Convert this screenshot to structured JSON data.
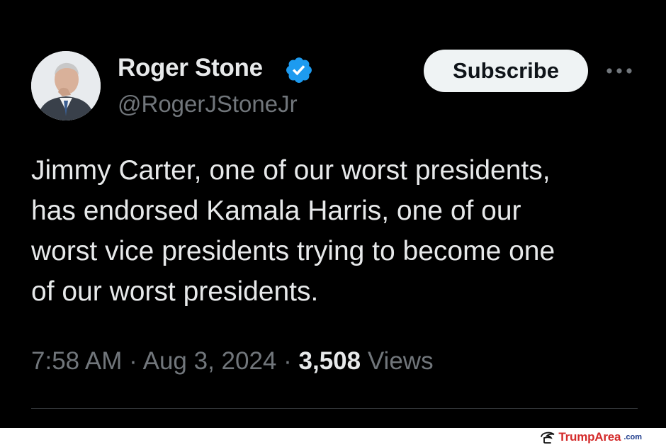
{
  "tweet": {
    "author": {
      "display_name": "Roger Stone",
      "handle": "@RogerJStoneJr",
      "verified": true,
      "verified_color": "#1d9bf0"
    },
    "subscribe_label": "Subscribe",
    "text": "Jimmy Carter, one of our worst presidents,\nhas endorsed Kamala Harris, one of our\nworst vice presidents trying to become one\nof our worst presidents.",
    "time": "7:58 AM",
    "separator": "·",
    "date": "Aug 3, 2024",
    "views_count": "3,508",
    "views_label": "Views"
  },
  "watermark": {
    "brand": "TrumpArea",
    "suffix": ".com"
  },
  "colors": {
    "background": "#000000",
    "text_primary": "#e7e9ea",
    "text_secondary": "#71767b",
    "button_bg": "#eff3f4"
  }
}
